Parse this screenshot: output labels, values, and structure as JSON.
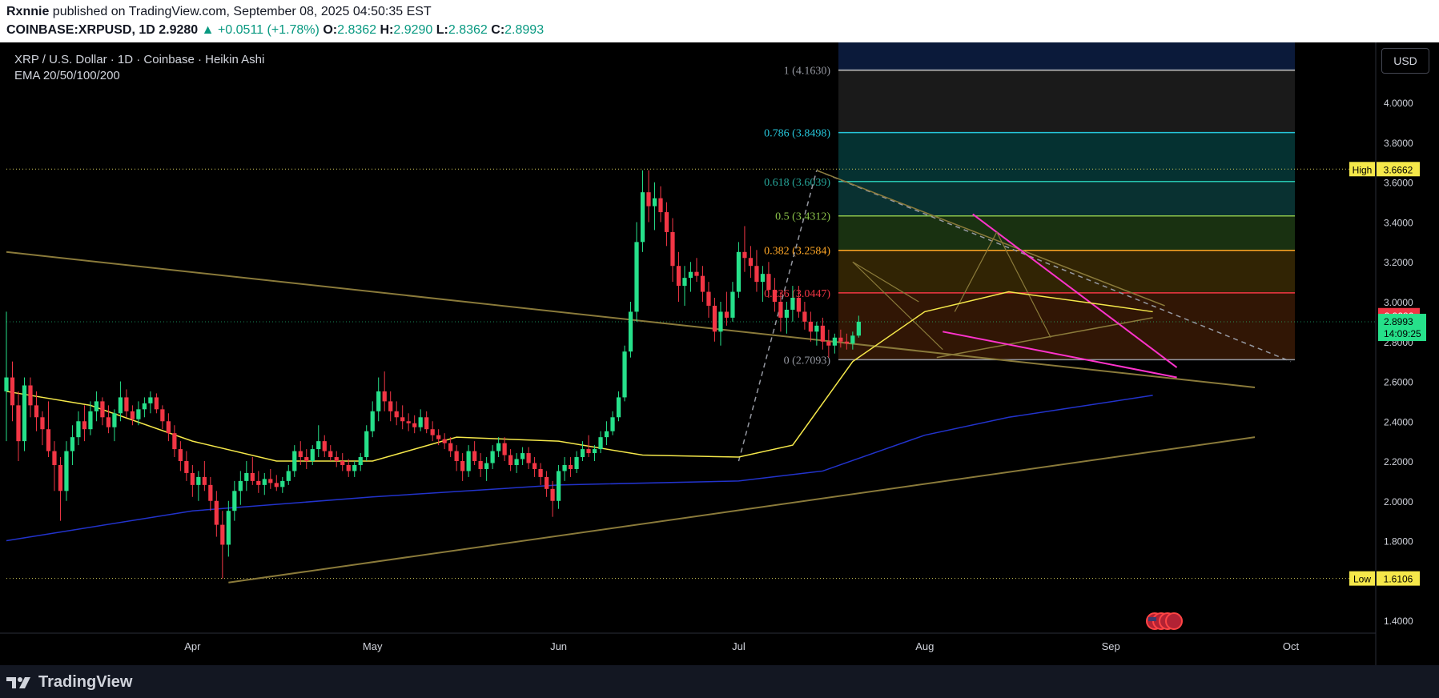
{
  "header": {
    "author": "Rxnnie",
    "published_text": "published on TradingView.com, September 08, 2025 04:50:35 EST",
    "symbol": "COINBASE:XRPUSD, 1D",
    "last": "2.9280",
    "change": "+0.0511 (+1.78%)",
    "o_label": "O:",
    "o": "2.8362",
    "h_label": "H:",
    "h": "2.9290",
    "l_label": "L:",
    "l": "2.8362",
    "c_label": "C:",
    "c": "2.8993"
  },
  "legend": {
    "title": "XRP / U.S. Dollar · 1D · Coinbase · Heikin Ashi",
    "indicator": "EMA 20/50/100/200"
  },
  "currency_button": "USD",
  "footer": {
    "brand": "TradingView"
  },
  "colors": {
    "bull": "#26e08a",
    "bear": "#f23645",
    "ema_yellow": "#f5e84a",
    "ema_blue": "#2233cc",
    "trend_line": "#8a7a3a",
    "wedge": "#ff33cc",
    "dashed": "#9598a1"
  },
  "chart_data": {
    "type": "candlestick",
    "title": "XRP / U.S. Dollar · 1D · Coinbase · Heikin Ashi",
    "x_ticks": [
      "Apr",
      "May",
      "Jun",
      "Jul",
      "Aug",
      "Sep",
      "Oct"
    ],
    "y_ticks": [
      "1.4000",
      "1.6000",
      "1.8000",
      "2.0000",
      "2.2000",
      "2.4000",
      "2.6000",
      "2.8000",
      "3.0000",
      "3.2000",
      "3.4000",
      "3.6000",
      "3.8000",
      "4.0000"
    ],
    "ylim": [
      1.38,
      4.3
    ],
    "x_range": [
      "2025-03-01",
      "2025-10-14"
    ],
    "candles_ohlc_daily_from_2025-03-01": [
      [
        2.55,
        2.95,
        2.3,
        2.62
      ],
      [
        2.62,
        2.7,
        2.4,
        2.48
      ],
      [
        2.48,
        2.55,
        2.2,
        2.3
      ],
      [
        2.3,
        2.62,
        2.25,
        2.58
      ],
      [
        2.58,
        2.62,
        2.42,
        2.48
      ],
      [
        2.48,
        2.55,
        2.35,
        2.42
      ],
      [
        2.42,
        2.45,
        2.28,
        2.36
      ],
      [
        2.36,
        2.5,
        2.22,
        2.25
      ],
      [
        2.25,
        2.3,
        2.05,
        2.18
      ],
      [
        2.18,
        2.22,
        1.9,
        2.05
      ],
      [
        2.05,
        2.3,
        2.0,
        2.25
      ],
      [
        2.25,
        2.38,
        2.18,
        2.32
      ],
      [
        2.32,
        2.45,
        2.28,
        2.4
      ],
      [
        2.4,
        2.48,
        2.3,
        2.36
      ],
      [
        2.36,
        2.5,
        2.33,
        2.45
      ],
      [
        2.45,
        2.55,
        2.4,
        2.5
      ],
      [
        2.5,
        2.52,
        2.38,
        2.42
      ],
      [
        2.42,
        2.48,
        2.34,
        2.37
      ],
      [
        2.37,
        2.46,
        2.3,
        2.44
      ],
      [
        2.44,
        2.6,
        2.4,
        2.52
      ],
      [
        2.52,
        2.56,
        2.42,
        2.45
      ],
      [
        2.45,
        2.48,
        2.38,
        2.41
      ],
      [
        2.41,
        2.5,
        2.38,
        2.46
      ],
      [
        2.46,
        2.52,
        2.42,
        2.49
      ],
      [
        2.49,
        2.55,
        2.44,
        2.52
      ],
      [
        2.52,
        2.54,
        2.44,
        2.46
      ],
      [
        2.46,
        2.48,
        2.36,
        2.4
      ],
      [
        2.4,
        2.44,
        2.3,
        2.34
      ],
      [
        2.34,
        2.38,
        2.22,
        2.26
      ],
      [
        2.26,
        2.3,
        2.15,
        2.2
      ],
      [
        2.2,
        2.25,
        2.1,
        2.14
      ],
      [
        2.14,
        2.18,
        2.02,
        2.08
      ],
      [
        2.08,
        2.15,
        2.0,
        2.12
      ],
      [
        2.12,
        2.2,
        2.05,
        2.08
      ],
      [
        2.08,
        2.12,
        1.95,
        2.0
      ],
      [
        2.0,
        2.05,
        1.82,
        1.88
      ],
      [
        1.88,
        1.95,
        1.61,
        1.78
      ],
      [
        1.78,
        2.0,
        1.72,
        1.95
      ],
      [
        1.95,
        2.1,
        1.9,
        2.05
      ],
      [
        2.05,
        2.15,
        1.98,
        2.1
      ],
      [
        2.1,
        2.2,
        2.05,
        2.14
      ],
      [
        2.14,
        2.22,
        2.08,
        2.1
      ],
      [
        2.1,
        2.15,
        2.04,
        2.08
      ],
      [
        2.08,
        2.14,
        2.03,
        2.11
      ],
      [
        2.11,
        2.16,
        2.06,
        2.09
      ],
      [
        2.09,
        2.13,
        2.05,
        2.07
      ],
      [
        2.07,
        2.12,
        2.04,
        2.1
      ],
      [
        2.1,
        2.18,
        2.08,
        2.15
      ],
      [
        2.15,
        2.28,
        2.12,
        2.25
      ],
      [
        2.25,
        2.3,
        2.18,
        2.22
      ],
      [
        2.22,
        2.26,
        2.16,
        2.2
      ],
      [
        2.2,
        2.28,
        2.18,
        2.26
      ],
      [
        2.26,
        2.38,
        2.22,
        2.3
      ],
      [
        2.3,
        2.33,
        2.22,
        2.25
      ],
      [
        2.25,
        2.28,
        2.2,
        2.22
      ],
      [
        2.22,
        2.25,
        2.17,
        2.2
      ],
      [
        2.2,
        2.24,
        2.15,
        2.18
      ],
      [
        2.18,
        2.21,
        2.12,
        2.15
      ],
      [
        2.15,
        2.2,
        2.12,
        2.18
      ],
      [
        2.18,
        2.24,
        2.15,
        2.22
      ],
      [
        2.22,
        2.38,
        2.2,
        2.35
      ],
      [
        2.35,
        2.5,
        2.32,
        2.45
      ],
      [
        2.45,
        2.62,
        2.4,
        2.55
      ],
      [
        2.55,
        2.65,
        2.45,
        2.5
      ],
      [
        2.5,
        2.55,
        2.4,
        2.45
      ],
      [
        2.45,
        2.5,
        2.38,
        2.42
      ],
      [
        2.42,
        2.48,
        2.36,
        2.4
      ],
      [
        2.4,
        2.44,
        2.35,
        2.39
      ],
      [
        2.39,
        2.43,
        2.34,
        2.37
      ],
      [
        2.37,
        2.46,
        2.35,
        2.42
      ],
      [
        2.42,
        2.45,
        2.34,
        2.36
      ],
      [
        2.36,
        2.4,
        2.3,
        2.33
      ],
      [
        2.33,
        2.36,
        2.28,
        2.31
      ],
      [
        2.31,
        2.34,
        2.26,
        2.29
      ],
      [
        2.29,
        2.32,
        2.22,
        2.25
      ],
      [
        2.25,
        2.28,
        2.15,
        2.2
      ],
      [
        2.2,
        2.24,
        2.1,
        2.15
      ],
      [
        2.15,
        2.28,
        2.12,
        2.25
      ],
      [
        2.25,
        2.3,
        2.18,
        2.2
      ],
      [
        2.2,
        2.24,
        2.12,
        2.16
      ],
      [
        2.16,
        2.22,
        2.1,
        2.19
      ],
      [
        2.19,
        2.28,
        2.16,
        2.25
      ],
      [
        2.25,
        2.32,
        2.22,
        2.29
      ],
      [
        2.29,
        2.32,
        2.2,
        2.23
      ],
      [
        2.23,
        2.26,
        2.15,
        2.18
      ],
      [
        2.18,
        2.24,
        2.14,
        2.21
      ],
      [
        2.21,
        2.27,
        2.18,
        2.24
      ],
      [
        2.24,
        2.27,
        2.16,
        2.19
      ],
      [
        2.19,
        2.22,
        2.12,
        2.16
      ],
      [
        2.16,
        2.19,
        2.08,
        2.12
      ],
      [
        2.12,
        2.15,
        2.02,
        2.06
      ],
      [
        2.06,
        2.1,
        1.92,
        2.0
      ],
      [
        2.0,
        2.18,
        1.96,
        2.15
      ],
      [
        2.15,
        2.22,
        2.1,
        2.18
      ],
      [
        2.18,
        2.22,
        2.12,
        2.16
      ],
      [
        2.16,
        2.25,
        2.14,
        2.22
      ],
      [
        2.22,
        2.3,
        2.2,
        2.26
      ],
      [
        2.26,
        2.33,
        2.22,
        2.24
      ],
      [
        2.24,
        2.28,
        2.2,
        2.26
      ],
      [
        2.26,
        2.35,
        2.24,
        2.32
      ],
      [
        2.32,
        2.4,
        2.28,
        2.35
      ],
      [
        2.35,
        2.45,
        2.33,
        2.42
      ],
      [
        2.42,
        2.55,
        2.4,
        2.52
      ],
      [
        2.52,
        2.78,
        2.5,
        2.75
      ],
      [
        2.75,
        3.0,
        2.72,
        2.95
      ],
      [
        2.95,
        3.4,
        2.9,
        3.3
      ],
      [
        3.3,
        3.66,
        3.25,
        3.55
      ],
      [
        3.55,
        3.66,
        3.4,
        3.48
      ],
      [
        3.48,
        3.6,
        3.36,
        3.52
      ],
      [
        3.52,
        3.58,
        3.4,
        3.45
      ],
      [
        3.45,
        3.5,
        3.28,
        3.35
      ],
      [
        3.35,
        3.42,
        3.1,
        3.18
      ],
      [
        3.18,
        3.25,
        3.0,
        3.08
      ],
      [
        3.08,
        3.18,
        2.98,
        3.12
      ],
      [
        3.12,
        3.2,
        3.05,
        3.15
      ],
      [
        3.15,
        3.22,
        3.1,
        3.13
      ],
      [
        3.13,
        3.18,
        3.0,
        3.05
      ],
      [
        3.05,
        3.1,
        2.92,
        2.98
      ],
      [
        2.98,
        3.02,
        2.8,
        2.85
      ],
      [
        2.85,
        3.0,
        2.78,
        2.95
      ],
      [
        2.95,
        3.05,
        2.88,
        2.92
      ],
      [
        2.92,
        3.1,
        2.9,
        3.05
      ],
      [
        3.05,
        3.3,
        3.02,
        3.25
      ],
      [
        3.25,
        3.38,
        3.15,
        3.22
      ],
      [
        3.22,
        3.28,
        3.12,
        3.18
      ],
      [
        3.18,
        3.26,
        3.05,
        3.1
      ],
      [
        3.1,
        3.18,
        3.0,
        3.14
      ],
      [
        3.14,
        3.2,
        3.02,
        3.06
      ],
      [
        3.06,
        3.12,
        2.95,
        3.0
      ],
      [
        3.0,
        3.05,
        2.85,
        2.92
      ],
      [
        2.92,
        3.0,
        2.84,
        2.96
      ],
      [
        2.96,
        3.08,
        2.9,
        3.02
      ],
      [
        3.02,
        3.08,
        2.92,
        2.95
      ],
      [
        2.95,
        3.0,
        2.86,
        2.9
      ],
      [
        2.9,
        2.95,
        2.8,
        2.85
      ],
      [
        2.85,
        2.9,
        2.78,
        2.88
      ],
      [
        2.88,
        2.92,
        2.76,
        2.8
      ],
      [
        2.8,
        2.86,
        2.72,
        2.78
      ],
      [
        2.78,
        2.84,
        2.74,
        2.82
      ],
      [
        2.82,
        2.86,
        2.77,
        2.8
      ],
      [
        2.8,
        2.84,
        2.76,
        2.79
      ],
      [
        2.79,
        2.85,
        2.76,
        2.83
      ],
      [
        2.83,
        2.93,
        2.82,
        2.9
      ]
    ],
    "ema_yellow_approx": [
      [
        "2025-03-01",
        2.55
      ],
      [
        "2025-03-15",
        2.48
      ],
      [
        "2025-04-01",
        2.3
      ],
      [
        "2025-04-15",
        2.2
      ],
      [
        "2025-05-01",
        2.2
      ],
      [
        "2025-05-15",
        2.32
      ],
      [
        "2025-06-01",
        2.3
      ],
      [
        "2025-06-15",
        2.23
      ],
      [
        "2025-07-01",
        2.22
      ],
      [
        "2025-07-10",
        2.28
      ],
      [
        "2025-07-20",
        2.7
      ],
      [
        "2025-08-01",
        2.95
      ],
      [
        "2025-08-15",
        3.05
      ],
      [
        "2025-09-01",
        2.98
      ],
      [
        "2025-09-08",
        2.95
      ]
    ],
    "ema_blue_approx": [
      [
        "2025-03-01",
        1.8
      ],
      [
        "2025-04-01",
        1.95
      ],
      [
        "2025-05-01",
        2.02
      ],
      [
        "2025-06-01",
        2.08
      ],
      [
        "2025-07-01",
        2.1
      ],
      [
        "2025-07-15",
        2.15
      ],
      [
        "2025-08-01",
        2.33
      ],
      [
        "2025-08-15",
        2.42
      ],
      [
        "2025-09-08",
        2.53
      ]
    ],
    "fib_levels": [
      {
        "ratio": "1",
        "price": "4.1630"
      },
      {
        "ratio": "0.786",
        "price": "3.8498"
      },
      {
        "ratio": "0.618",
        "price": "3.6039"
      },
      {
        "ratio": "0.5",
        "price": "3.4312"
      },
      {
        "ratio": "0.382",
        "price": "3.2584"
      },
      {
        "ratio": "0.236",
        "price": "3.0447"
      },
      {
        "ratio": "0",
        "price": "2.7093"
      }
    ],
    "high_marker": {
      "label": "High",
      "value": "3.6662"
    },
    "low_marker": {
      "label": "Low",
      "value": "1.6106"
    },
    "price_labels": {
      "prev": "2.9286",
      "last": "2.8993",
      "countdown": "14:09:25"
    }
  }
}
